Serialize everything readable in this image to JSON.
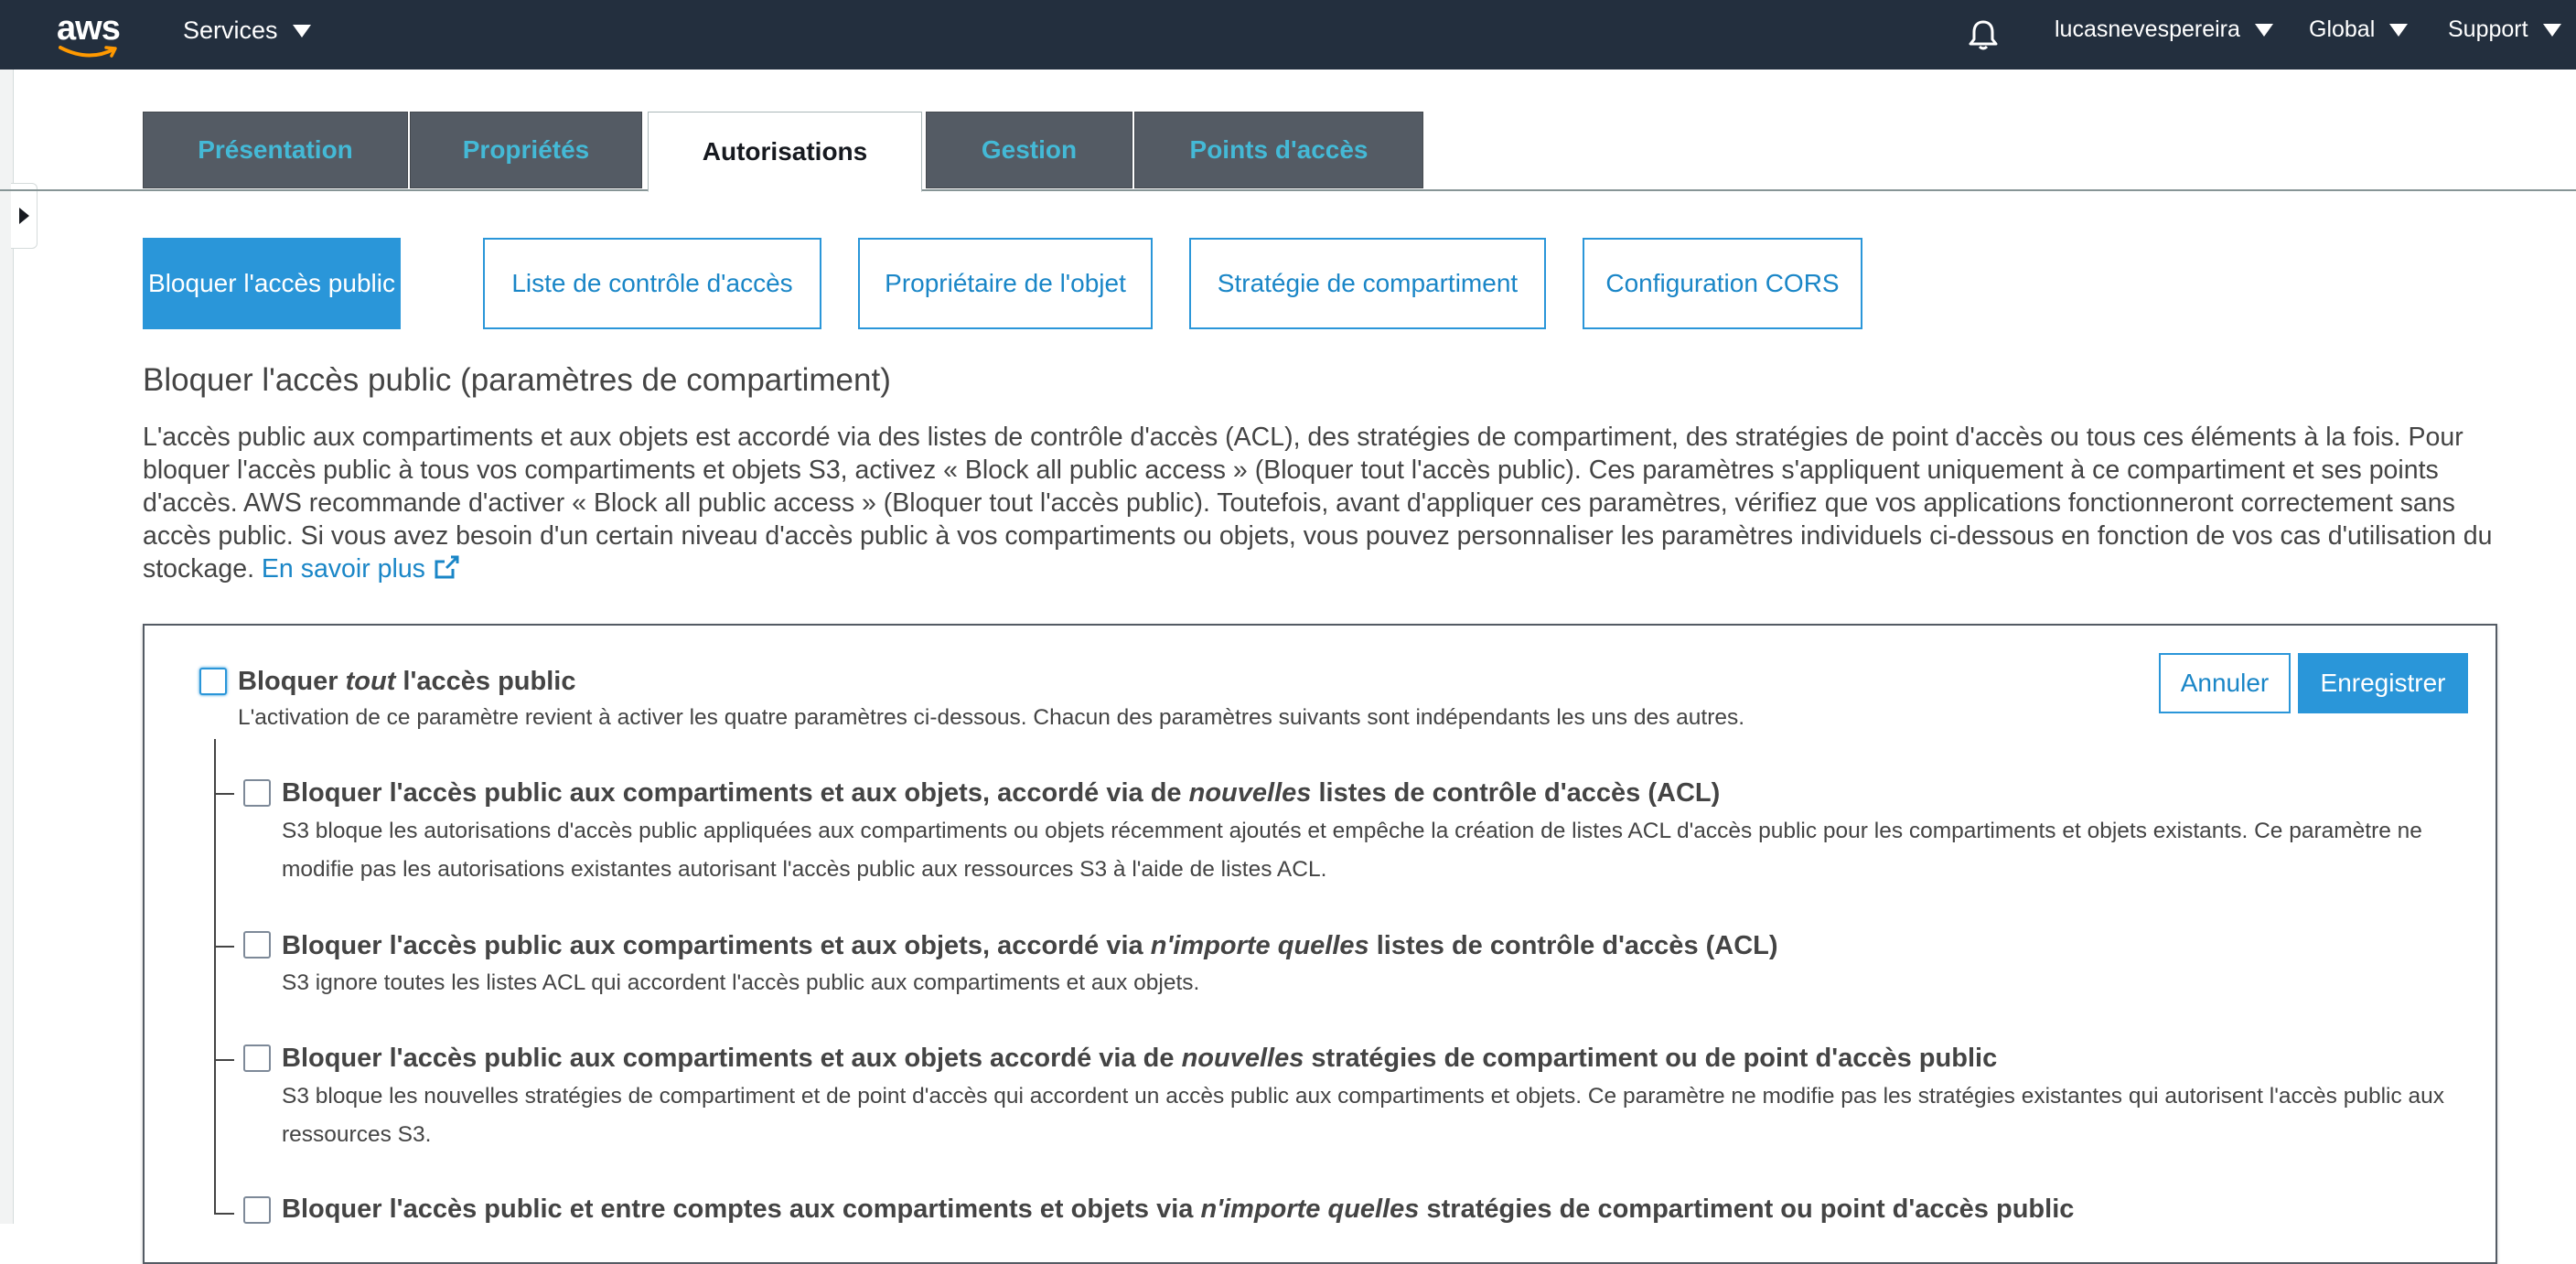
{
  "topnav": {
    "logo_text": "aws",
    "services": "Services",
    "user": "lucasnevespereira",
    "region": "Global",
    "support": "Support",
    "bg_color": "#232f3e"
  },
  "tabs": [
    {
      "label": "Présentation",
      "active": false
    },
    {
      "label": "Propriétés",
      "active": false
    },
    {
      "label": "Autorisations",
      "active": true
    },
    {
      "label": "Gestion",
      "active": false
    },
    {
      "label": "Points d'accès",
      "active": false
    }
  ],
  "subtabs": [
    {
      "label": "Bloquer l'accès public",
      "active": true
    },
    {
      "label": "Liste de contrôle d'accès",
      "active": false
    },
    {
      "label": "Propriétaire de l'objet",
      "active": false
    },
    {
      "label": "Stratégie de compartiment",
      "active": false
    },
    {
      "label": "Configuration CORS",
      "active": false
    }
  ],
  "section": {
    "title": "Bloquer l'accès public (paramètres de compartiment)",
    "description": "L'accès public aux compartiments et aux objets est accordé via des listes de contrôle d'accès (ACL), des stratégies de compartiment, des stratégies de point d'accès ou tous ces éléments à la fois. Pour bloquer l'accès public à tous vos compartiments et objets S3, activez « Block all public access » (Bloquer tout l'accès public). Ces paramètres s'appliquent uniquement à ce compartiment et ses points d'accès. AWS recommande d'activer « Block all public access » (Bloquer tout l'accès public). Toutefois, avant d'appliquer ces paramètres, vérifiez que vos applications fonctionneront correctement sans accès public. Si vous avez besoin d'un certain niveau d'accès public à vos compartiments ou objets, vous pouvez personnaliser les paramètres individuels ci-dessous en fonction de vos cas d'utilisation du stockage.",
    "learn_more": "En savoir plus"
  },
  "panel": {
    "cancel_label": "Annuler",
    "save_label": "Enregistrer",
    "block_all": {
      "title_pre": "Bloquer ",
      "title_em": "tout",
      "title_post": " l'accès public",
      "desc": "L'activation de ce paramètre revient à activer les quatre paramètres ci-dessous. Chacun des paramètres suivants sont indépendants les uns des autres.",
      "checked": false
    },
    "options": [
      {
        "title_pre": "Bloquer l'accès public aux compartiments et aux objets, accordé via de ",
        "title_em": "nouvelles",
        "title_post": " listes de contrôle d'accès (ACL)",
        "desc": "S3 bloque les autorisations d'accès public appliquées aux compartiments ou objets récemment ajoutés et empêche la création de listes ACL d'accès public pour les compartiments et objets existants. Ce paramètre ne modifie pas les autorisations existantes autorisant l'accès public aux ressources S3 à l'aide de listes ACL.",
        "checked": false
      },
      {
        "title_pre": "Bloquer l'accès public aux compartiments et aux objets, accordé via ",
        "title_em": "n'importe quelles",
        "title_post": " listes de contrôle d'accès (ACL)",
        "desc": "S3 ignore toutes les listes ACL qui accordent l'accès public aux compartiments et aux objets.",
        "checked": false
      },
      {
        "title_pre": "Bloquer l'accès public aux compartiments et aux objets accordé via de ",
        "title_em": "nouvelles",
        "title_post": " stratégies de compartiment ou de point d'accès public",
        "desc": "S3 bloque les nouvelles stratégies de compartiment et de point d'accès qui accordent un accès public aux compartiments et objets. Ce paramètre ne modifie pas les stratégies existantes qui autorisent l'accès public aux ressources S3.",
        "checked": false
      },
      {
        "title_pre": "Bloquer l'accès public et entre comptes aux compartiments et objets via ",
        "title_em": "n'importe quelles",
        "title_post": " stratégies de compartiment ou point d'accès public",
        "desc": "",
        "checked": false
      }
    ]
  },
  "colors": {
    "accent": "#2a96d9",
    "tab_bg": "#545b64",
    "tab_text": "#44b9d6"
  }
}
